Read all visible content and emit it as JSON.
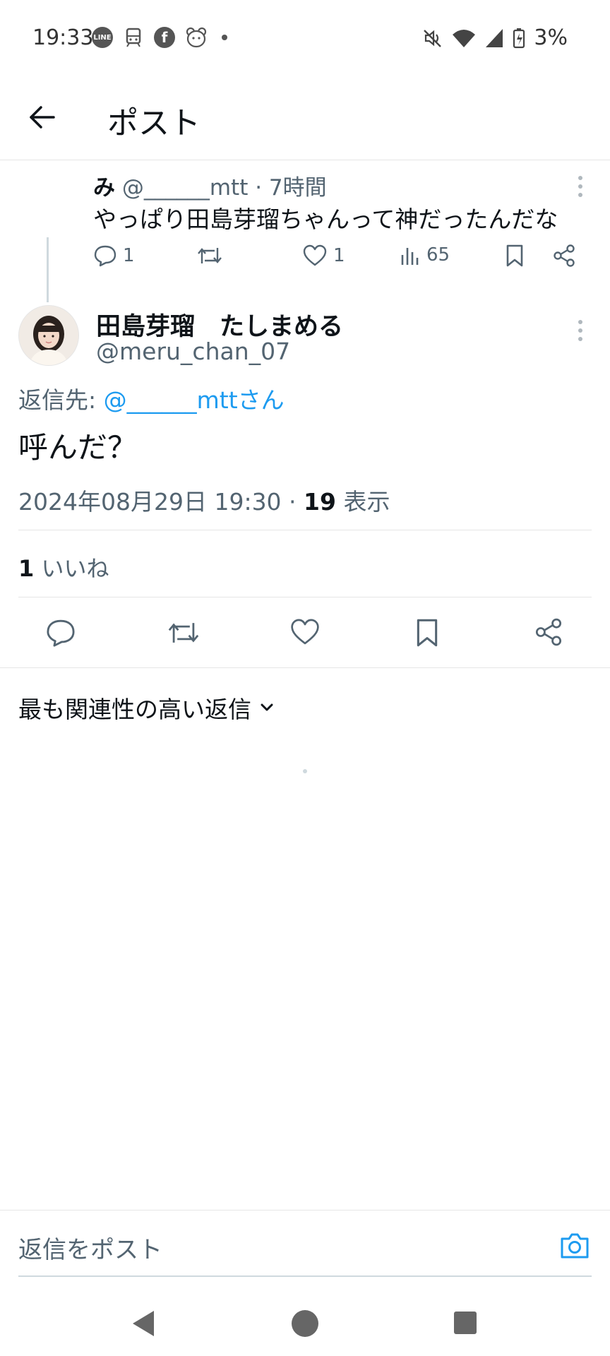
{
  "status_bar": {
    "time": "19:33",
    "left_icons": [
      "line-icon",
      "train-icon",
      "facebook-icon",
      "bear-app-icon",
      "dot"
    ],
    "battery": "3%"
  },
  "header": {
    "title": "ポスト"
  },
  "parent_post": {
    "name": "み",
    "handle_time": "@______mtt · 7時間",
    "text": "やっぱり田島芽瑠ちゃんって神だったんだな",
    "replies": "1",
    "likes": "1",
    "views": "65"
  },
  "main_post": {
    "display_name": "田島芽瑠　たしまめる",
    "handle": "@meru_chan_07",
    "reply_to_prefix": "返信先: ",
    "reply_to_user": "@______mttさん",
    "text": "呼んだ？",
    "timestamp": "2024年08月29日 19:30 · ",
    "views_count": "19",
    "views_label": " 表示",
    "likes_count": "1",
    "likes_label": " いいね"
  },
  "replies_sort": {
    "label": "最も関連性の高い返信"
  },
  "reply_bar": {
    "placeholder": "返信をポスト"
  },
  "colors": {
    "accent": "#1d9bf0",
    "text": "#0f1419",
    "muted": "#536471"
  }
}
